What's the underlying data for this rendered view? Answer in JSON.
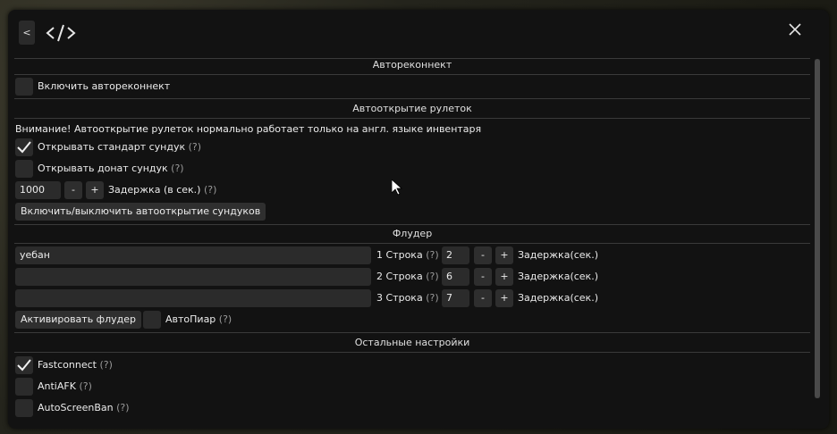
{
  "window": {
    "back_label": "<",
    "logo_icon": "code-icon",
    "close_icon": "close-icon"
  },
  "autoreconnect": {
    "header": "Автореконнект",
    "enable_label": "Включить автореконнект",
    "enabled": false
  },
  "roulette": {
    "header": "Автооткрытие рулеток",
    "warning": "Внимание! Автооткрытие рулеток нормально работает только на англ. языке инвентаря",
    "standard_chest_label": "Открывать стандарт сундук",
    "standard_chest_checked": true,
    "donate_chest_label": "Открывать донат сундук",
    "donate_chest_checked": false,
    "hint": "(?)",
    "delay_value": "1000",
    "minus": "-",
    "plus": "+",
    "delay_label": "Задержка (в сек.)",
    "toggle_button": "Включить/выключить автооткрытие сундуков"
  },
  "flooder": {
    "header": "Флудер",
    "rows": [
      {
        "text": "уебан",
        "row_label": "1 Строка",
        "delay": "2"
      },
      {
        "text": "",
        "row_label": "2 Строка",
        "delay": "6"
      },
      {
        "text": "",
        "row_label": "3 Строка",
        "delay": "7"
      }
    ],
    "hint": "(?)",
    "minus": "-",
    "plus": "+",
    "delay_label": "Задержка(сек.)",
    "activate_button": "Активировать флудер",
    "autopr_label": "АвтоПиар",
    "autopr_checked": false
  },
  "other": {
    "header": "Остальные настройки",
    "hint": "(?)",
    "items": [
      {
        "label": "Fastconnect",
        "checked": true
      },
      {
        "label": "AntiAFK",
        "checked": false
      },
      {
        "label": "AutoScreenBan",
        "checked": false
      }
    ]
  }
}
